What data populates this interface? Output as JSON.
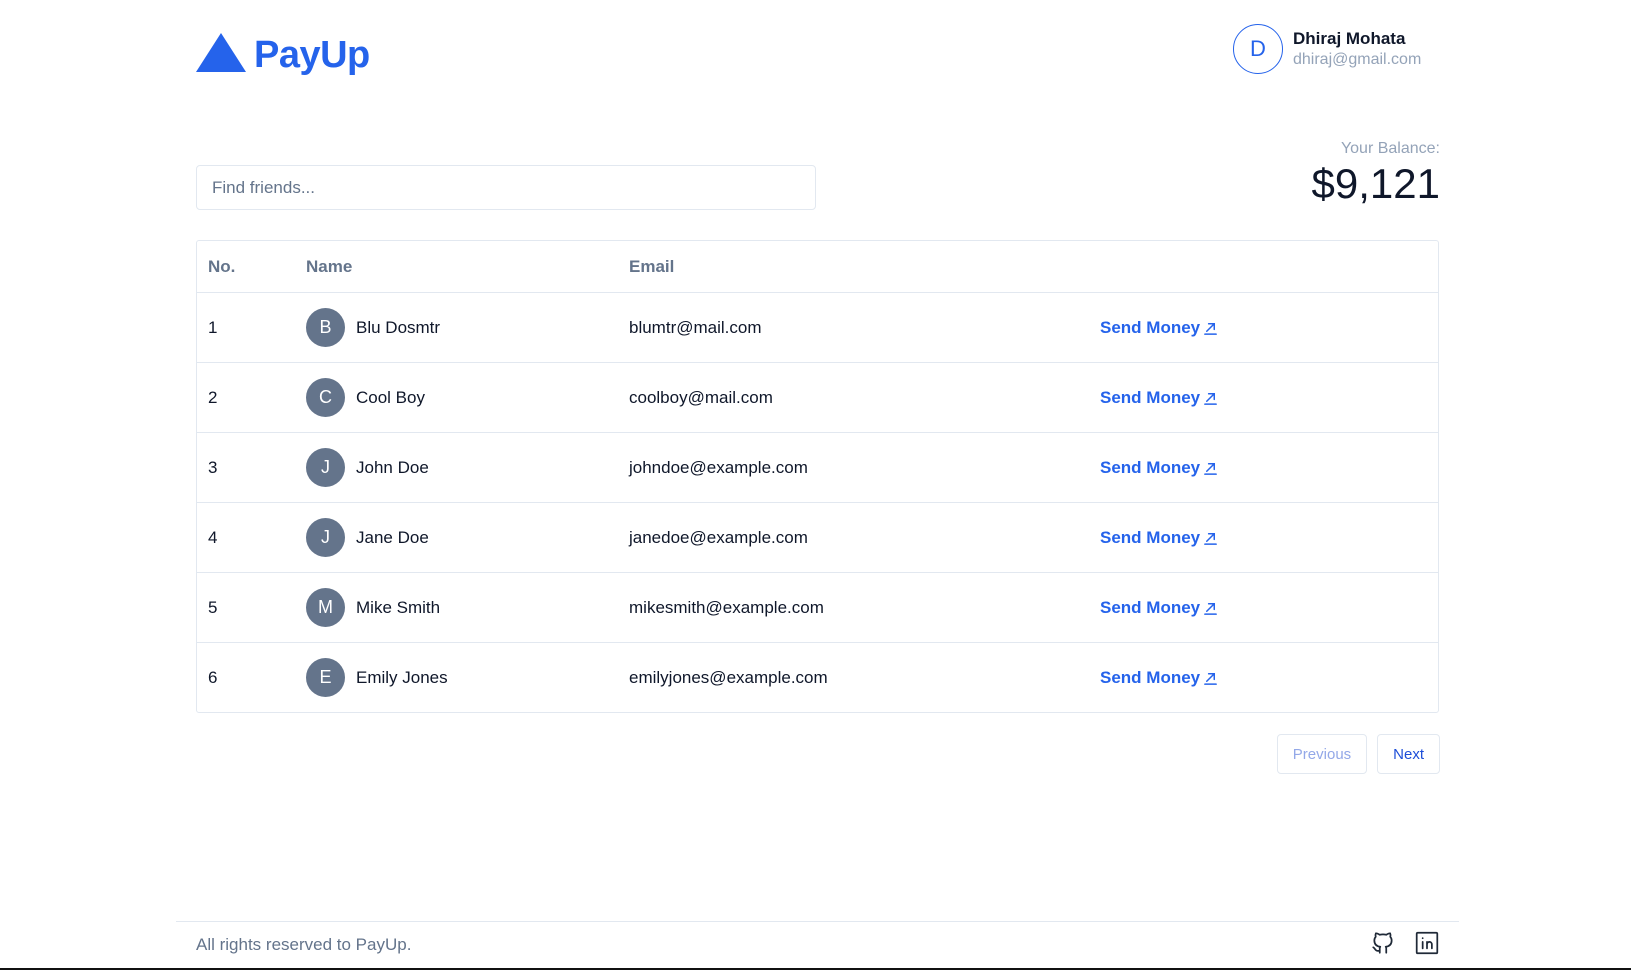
{
  "app": {
    "brand": "PayUp"
  },
  "user": {
    "initial": "D",
    "name": "Dhiraj Mohata",
    "email": "dhiraj@gmail.com"
  },
  "search": {
    "placeholder": "Find friends..."
  },
  "balance": {
    "label": "Your Balance:",
    "value": "$9,121"
  },
  "table": {
    "headers": {
      "no": "No.",
      "name": "Name",
      "email": "Email"
    },
    "action_label": "Send Money",
    "rows": [
      {
        "no": "1",
        "initial": "B",
        "name": "Blu Dosmtr",
        "email": "blumtr@mail.com"
      },
      {
        "no": "2",
        "initial": "C",
        "name": "Cool Boy",
        "email": "coolboy@mail.com"
      },
      {
        "no": "3",
        "initial": "J",
        "name": "John Doe",
        "email": "johndoe@example.com"
      },
      {
        "no": "4",
        "initial": "J",
        "name": "Jane Doe",
        "email": "janedoe@example.com"
      },
      {
        "no": "5",
        "initial": "M",
        "name": "Mike Smith",
        "email": "mikesmith@example.com"
      },
      {
        "no": "6",
        "initial": "E",
        "name": "Emily Jones",
        "email": "emilyjones@example.com"
      }
    ]
  },
  "pagination": {
    "previous": "Previous",
    "next": "Next"
  },
  "footer": {
    "text": "All rights reserved to PayUp.",
    "icons": [
      "github-icon",
      "linkedin-icon"
    ]
  },
  "colors": {
    "brand": "#2563eb",
    "avatar_bg": "#64748b",
    "muted": "#94a3b8"
  }
}
